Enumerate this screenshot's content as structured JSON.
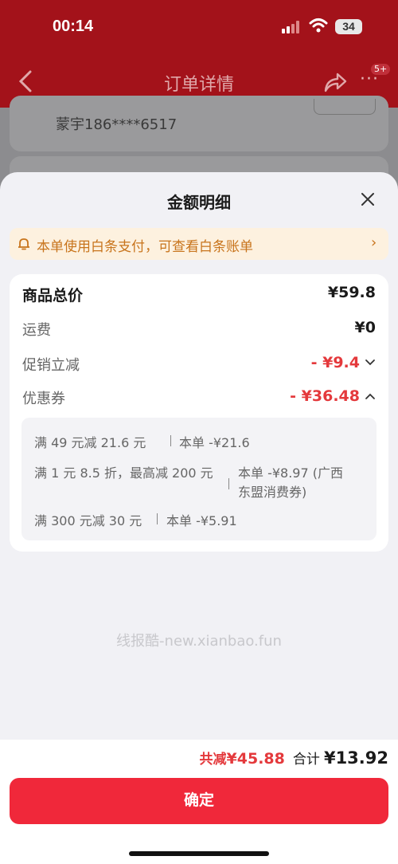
{
  "status_bar": {
    "time": "00:14",
    "battery": "34"
  },
  "nav": {
    "title": "订单详情",
    "badge": "5+"
  },
  "background": {
    "customer": "蒙宇186****6517"
  },
  "sheet": {
    "title": "金额明细",
    "notice": "本单使用白条支付，可查看白条账单",
    "rows": {
      "total": {
        "label": "商品总价",
        "value": "¥59.8"
      },
      "shipping": {
        "label": "运费",
        "value": "¥0"
      },
      "promo": {
        "label": "促销立减",
        "value": "- ¥9.4"
      },
      "coupon": {
        "label": "优惠券",
        "value": "- ¥36.48"
      }
    },
    "coupons": [
      {
        "name": "满 49 元减 21.6 元",
        "detail": "本单 -¥21.6"
      },
      {
        "name": "满 1 元 8.5 折，最高减 200 元",
        "detail_line1": "本单 -¥8.97 (广西",
        "detail_line2": "东盟消费券)"
      },
      {
        "name": "满 300 元减 30 元",
        "detail": "本单 -¥5.91"
      }
    ]
  },
  "watermark": "线报酷-new.xianbao.fun",
  "footer": {
    "discount_label": "共减",
    "discount_value": "¥45.88",
    "total_label": "合计",
    "total_value": "¥13.92",
    "confirm_label": "确定"
  },
  "colors": {
    "accent": "#f0283a",
    "price_red": "#e4393c",
    "notice_bg": "#fdf1df",
    "notice_text": "#c8741c"
  }
}
